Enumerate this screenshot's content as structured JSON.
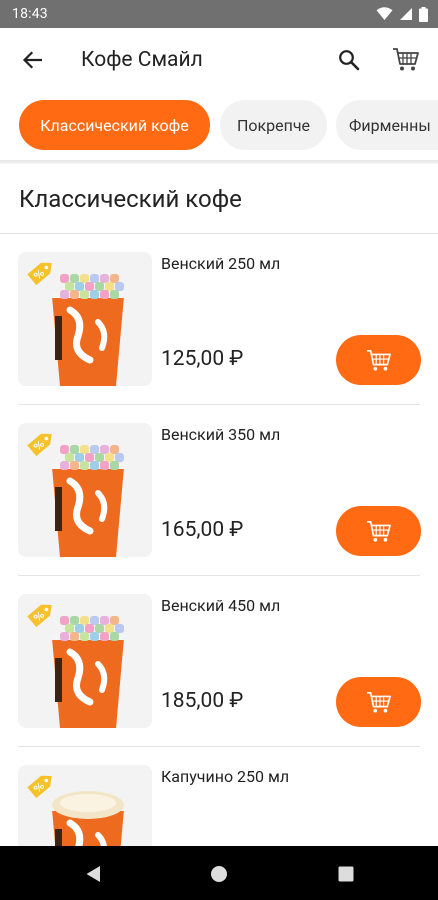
{
  "status_bar": {
    "time": "18:43"
  },
  "app_bar": {
    "title": "Кофе Смайл",
    "icons": [
      "back-arrow-icon",
      "search-icon",
      "cart-icon"
    ]
  },
  "categories": [
    {
      "label": "Классический кофе",
      "selected": true
    },
    {
      "label": "Покрепче",
      "selected": false
    },
    {
      "label": "Фирменны",
      "selected": false
    }
  ],
  "section": {
    "title": "Классический кофе"
  },
  "products": [
    {
      "name": "Венский 250 мл",
      "price": "125,00 ₽",
      "topping": "marshmallow"
    },
    {
      "name": "Венский 350 мл",
      "price": "165,00 ₽",
      "topping": "marshmallow"
    },
    {
      "name": "Венский 450 мл",
      "price": "185,00 ₽",
      "topping": "marshmallow"
    },
    {
      "name": "Капучино 250 мл",
      "price": "",
      "topping": "foam"
    }
  ],
  "colors": {
    "accent": "#FF6A13",
    "chip_inactive": "#F2F2F2",
    "status_bar": "#707070",
    "nav_bar": "#000000"
  }
}
